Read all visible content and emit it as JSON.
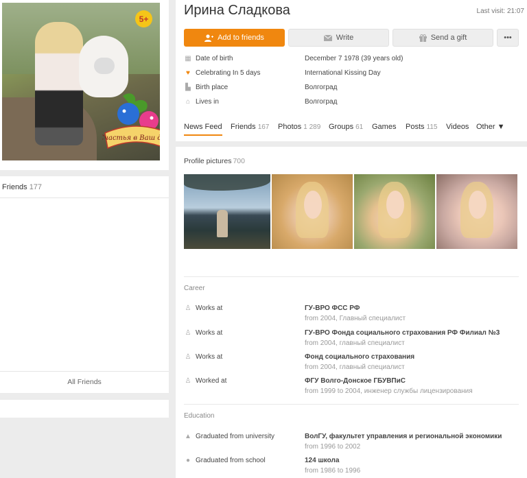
{
  "left": {
    "age_badge": "5+",
    "avatar_caption": "Счастья в Ваш дом!",
    "friends_label": "Friends",
    "friends_count": "177",
    "all_friends": "All Friends"
  },
  "profile": {
    "name": "Ирина Сладкова",
    "last_visit": "Last visit: 21:07"
  },
  "actions": {
    "add_friends": "Add to friends",
    "write": "Write",
    "gift": "Send a gift",
    "more": "•••"
  },
  "info": [
    {
      "icon": "calendar-icon",
      "label": "Date of birth",
      "value": "December 7 1978 (39 years old)"
    },
    {
      "icon": "heart-balloon-icon",
      "label": "Celebrating In 5 days",
      "value": "International Kissing Day"
    },
    {
      "icon": "building-icon",
      "label": "Birth place",
      "value": "Волгоград"
    },
    {
      "icon": "home-icon",
      "label": "Lives in",
      "value": "Волгоград"
    }
  ],
  "tabs": [
    {
      "label": "News Feed",
      "count": ""
    },
    {
      "label": "Friends",
      "count": "167"
    },
    {
      "label": "Photos",
      "count": "1 289"
    },
    {
      "label": "Groups",
      "count": "61"
    },
    {
      "label": "Games",
      "count": ""
    },
    {
      "label": "Posts",
      "count": "115"
    },
    {
      "label": "Videos",
      "count": ""
    },
    {
      "label": "Other ▼",
      "count": ""
    }
  ],
  "pictures": {
    "title": "Profile pictures",
    "count": "700"
  },
  "career": {
    "title": "Career",
    "rows": [
      {
        "label": "Works at",
        "org": "ГУ-ВРО ФСС РФ",
        "sub": "from 2004, Главный специалист"
      },
      {
        "label": "Works at",
        "org": "ГУ-ВРО Фонда социального страхования РФ Филиал №3",
        "sub": "from 2004, главный специалист"
      },
      {
        "label": "Works at",
        "org": "Фонд социального страхования",
        "sub": "from 2004, главный специалист"
      },
      {
        "label": "Worked at",
        "org": "ФГУ Волго-Донское ГБУВПиС",
        "sub": "from 1999 to 2004, инженер службы лицензирования"
      }
    ]
  },
  "education": {
    "title": "Education",
    "rows": [
      {
        "label": "Graduated from university",
        "org": "ВолГУ, факультет управления и региональной экономики",
        "sub": "from 1996 to 2002"
      },
      {
        "label": "Graduated from school",
        "org": "124 школа",
        "sub": "from 1986 to 1996"
      }
    ]
  }
}
